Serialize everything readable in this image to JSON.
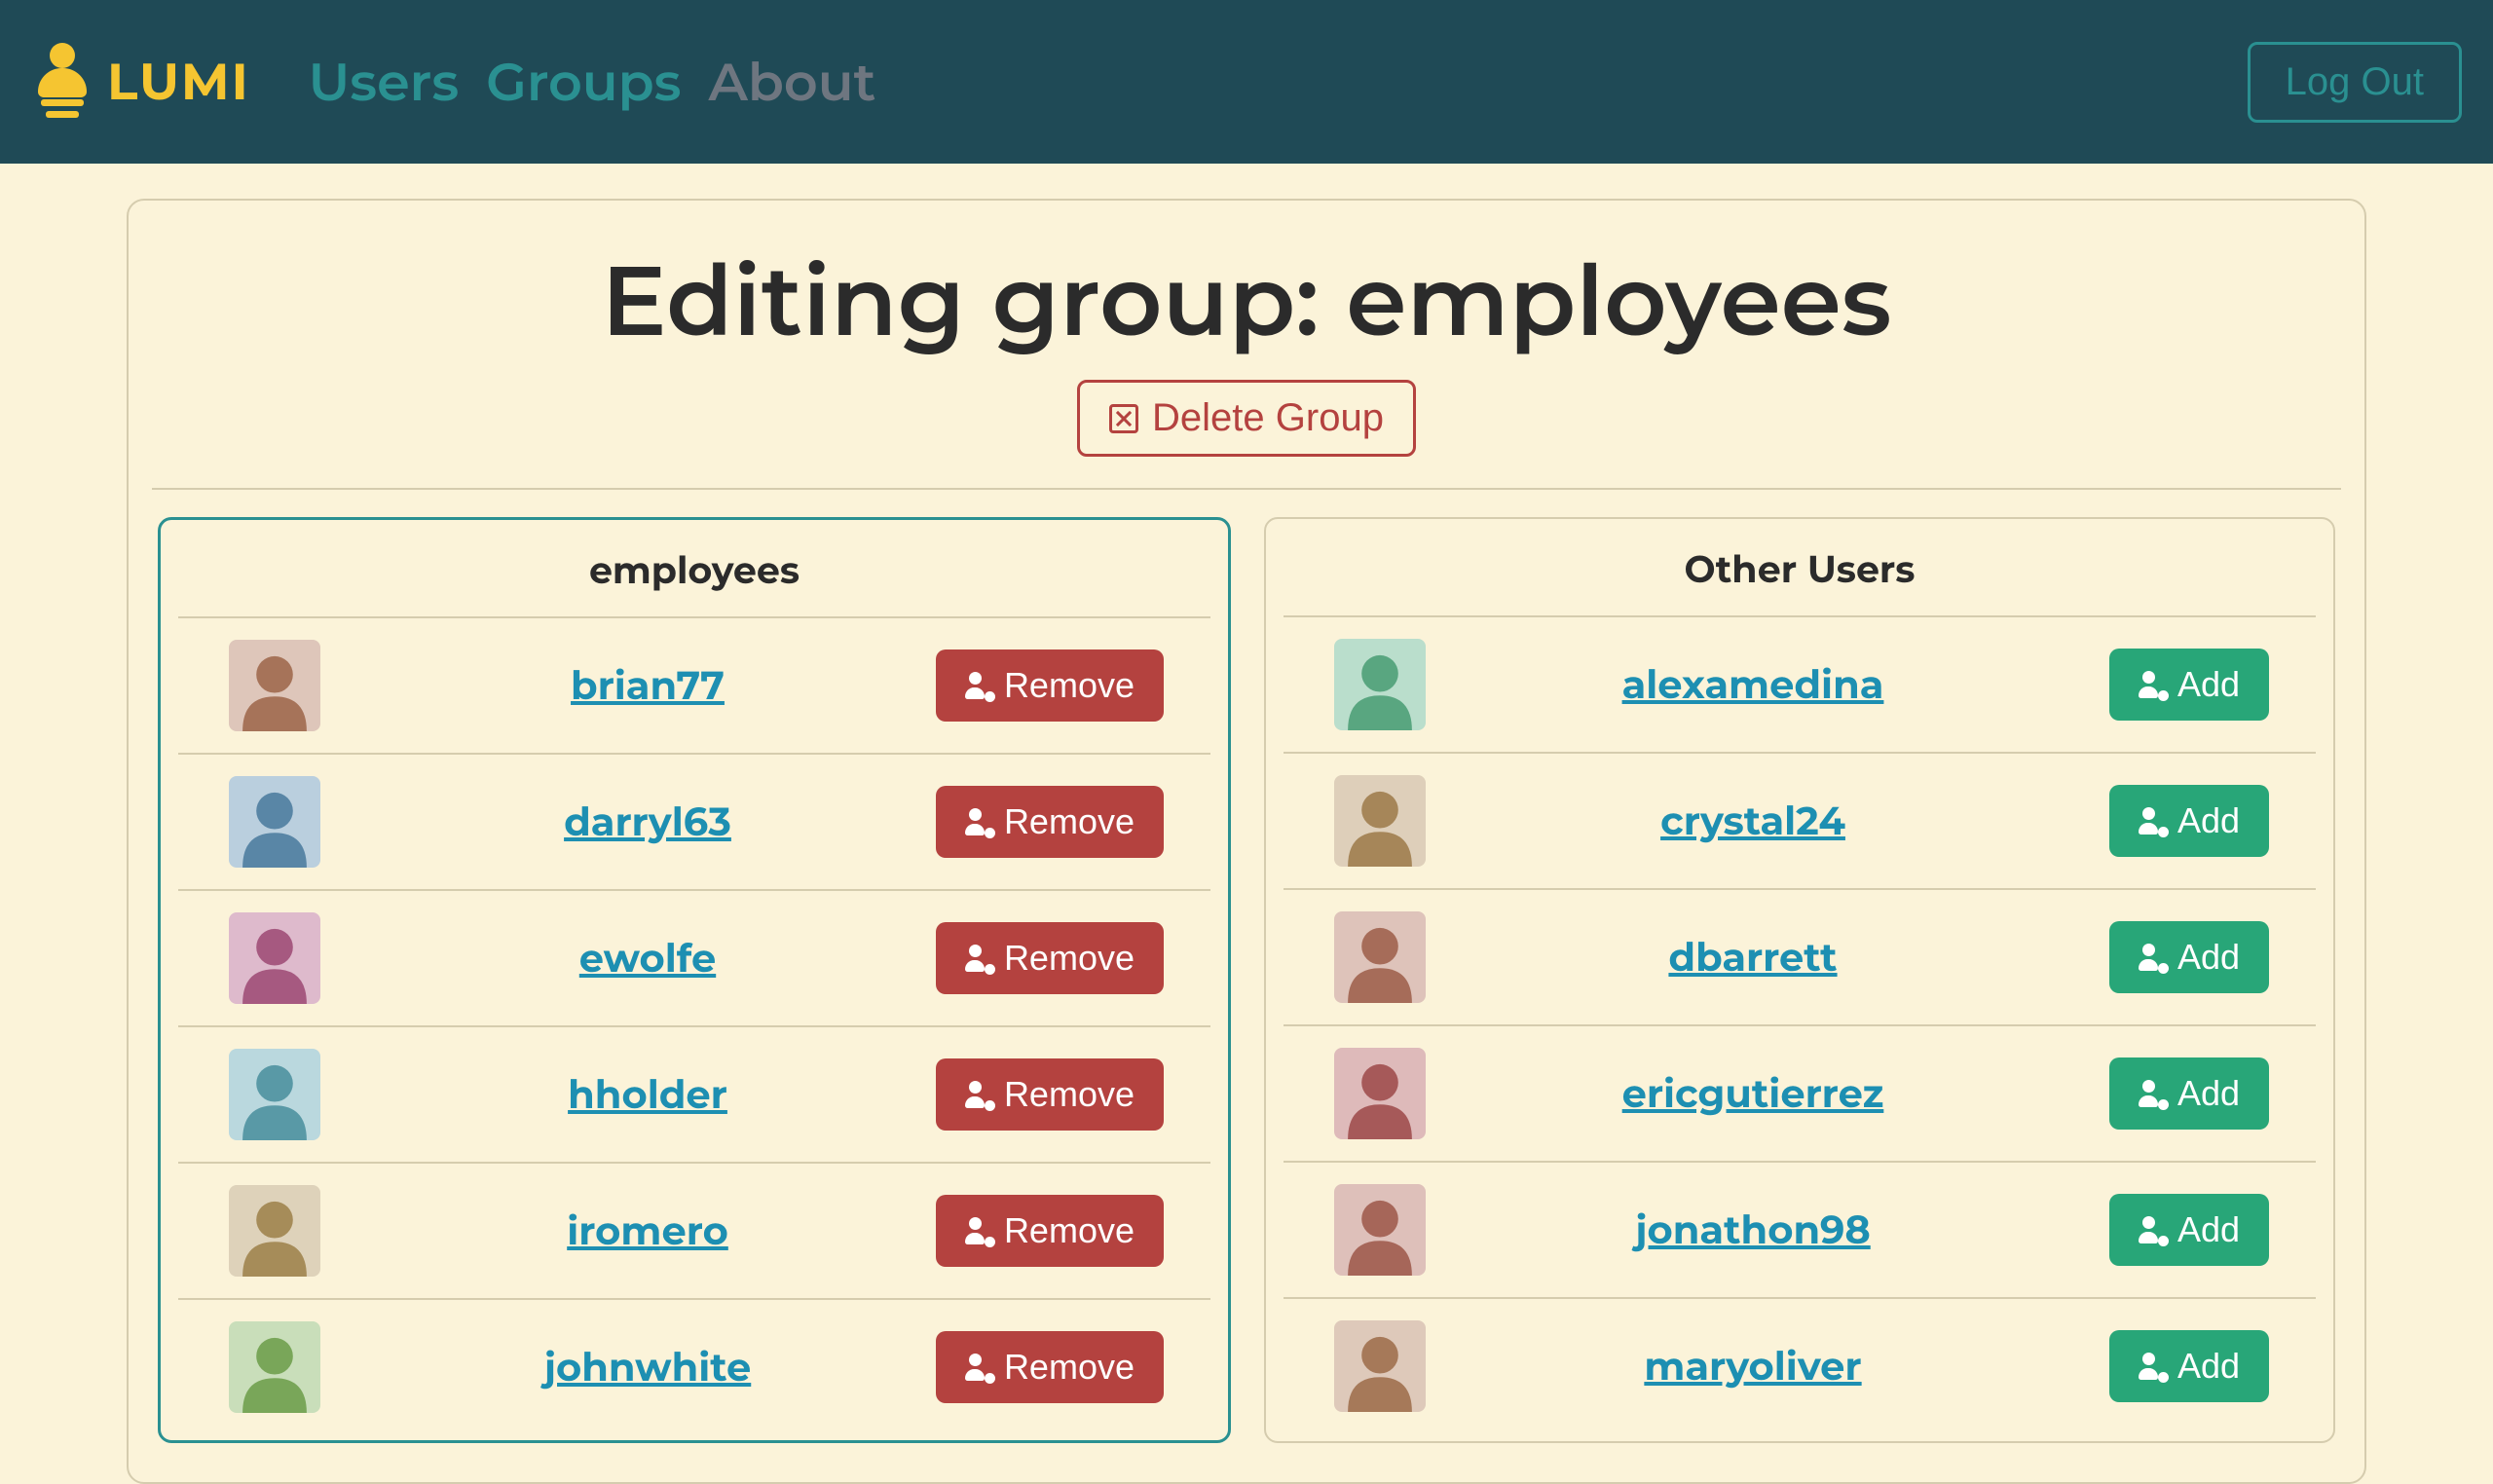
{
  "brand": {
    "name": "LUMI"
  },
  "nav": {
    "users": "Users",
    "groups": "Groups",
    "about": "About",
    "logout": "Log Out"
  },
  "page": {
    "title_prefix": "Editing group: ",
    "group_name": "employees",
    "delete_label": "Delete Group"
  },
  "labels": {
    "members_header": "employees",
    "others_header": "Other Users",
    "remove": "Remove",
    "add": "Add"
  },
  "members": [
    {
      "username": "brian77",
      "avatar_hue": 20
    },
    {
      "username": "darryl63",
      "avatar_hue": 205
    },
    {
      "username": "ewolfe",
      "avatar_hue": 330
    },
    {
      "username": "hholder",
      "avatar_hue": 190
    },
    {
      "username": "iromero",
      "avatar_hue": 40
    },
    {
      "username": "johnwhite",
      "avatar_hue": 95
    }
  ],
  "others": [
    {
      "username": "alexamedina",
      "avatar_hue": 150
    },
    {
      "username": "crystal24",
      "avatar_hue": 35
    },
    {
      "username": "dbarrett",
      "avatar_hue": 15
    },
    {
      "username": "ericgutierrez",
      "avatar_hue": 0
    },
    {
      "username": "jonathon98",
      "avatar_hue": 10
    },
    {
      "username": "maryoliver",
      "avatar_hue": 25
    }
  ]
}
